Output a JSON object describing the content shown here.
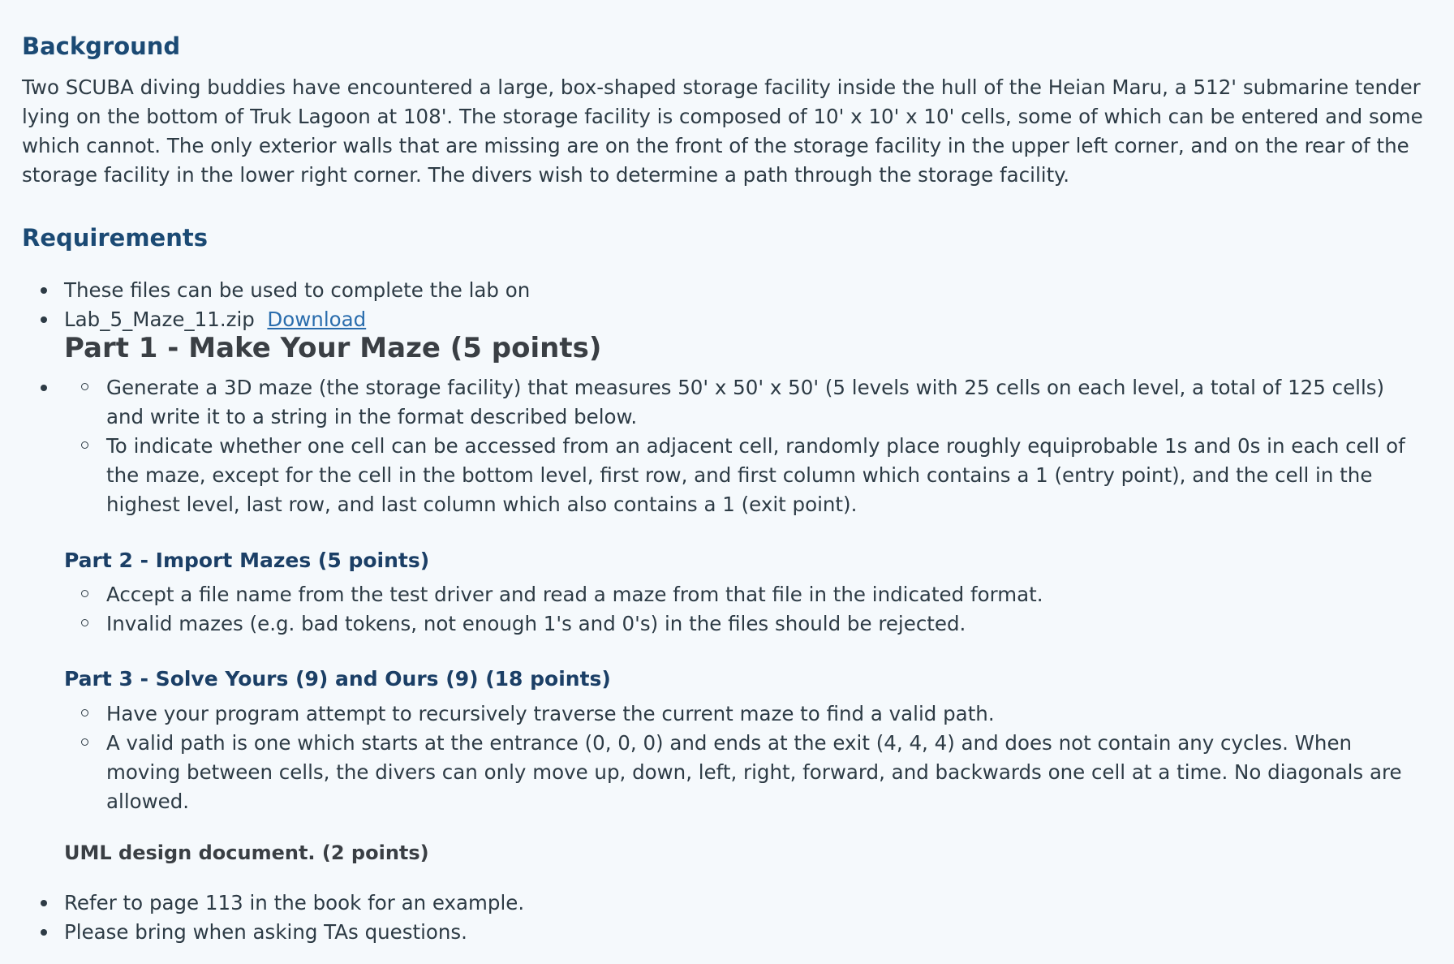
{
  "background": {
    "heading": "Background",
    "paragraph": "Two SCUBA diving buddies have encountered a large, box-shaped storage facility inside the hull of the Heian Maru, a 512' submarine tender lying on the bottom of Truk Lagoon at 108'. The storage facility is composed of 10' x 10' x 10' cells, some of which can be entered and some which cannot. The only exterior walls that are missing are on the front of the storage facility in the upper left corner, and on the rear of the storage facility in the lower right corner. The divers wish to determine a path through the storage facility."
  },
  "requirements": {
    "heading": "Requirements",
    "items": [
      {
        "text": "These files can be used to complete the lab on"
      },
      {
        "text": "Lab_5_Maze_11.zip",
        "link": "Download"
      }
    ]
  },
  "part1": {
    "heading": "Part 1 - Make Your Maze (5 points)",
    "items": [
      "Generate a 3D maze (the storage facility) that measures 50' x 50' x 50' (5 levels with 25 cells on each level, a total of 125 cells) and write it to a string in the format described below.",
      "To indicate whether one cell can be accessed from an adjacent cell, randomly place roughly equiprobable 1s and 0s in each cell of the maze, except for the cell in the bottom level, first row, and first column which contains a 1 (entry point), and the cell in the highest level, last row, and last column which also contains a 1 (exit point)."
    ]
  },
  "part2": {
    "heading": "Part 2 - Import Mazes (5 points)",
    "items": [
      "Accept a file name from the test driver and read a maze from that file in the indicated format.",
      "Invalid mazes (e.g. bad tokens, not enough 1's and 0's) in the files should be rejected."
    ]
  },
  "part3": {
    "heading": "Part 3 - Solve Yours (9) and Ours (9) (18 points)",
    "items": [
      "Have your program attempt to recursively traverse the current maze to find a valid path.",
      "A valid path is one which starts at the entrance (0, 0, 0) and ends at the exit (4, 4, 4) and does not contain any cycles. When moving between cells, the divers can only move up, down, left, right, forward, and backwards one cell at a time. No diagonals are allowed."
    ]
  },
  "uml": {
    "heading": "UML design document. (2 points)",
    "items": [
      "Refer to page 113 in the book for an example.",
      "Please bring when asking TAs questions."
    ]
  }
}
